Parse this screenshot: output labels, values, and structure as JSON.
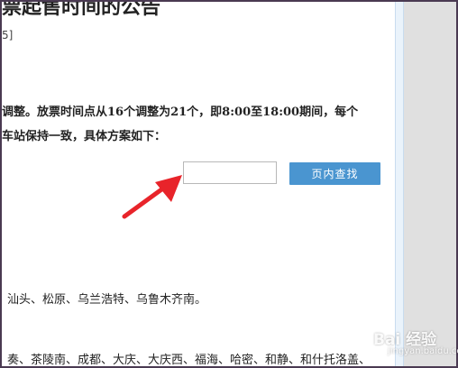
{
  "article": {
    "title": "票起售时间的公告",
    "subnote": "5]",
    "paragraph_line1": "调整。放票时间点从16个调整为21个，即8:00至18:00期间，每个",
    "paragraph_line2": "车站保持一致，具体方案如下：",
    "station_line1": "汕头、松原、乌兰浩特、乌鲁木齐南。",
    "station_line2": "奏、茶陵南、成都、大庆、大庆西、福海、哈密、和静、和什托洛盖、"
  },
  "find_bar": {
    "input_value": "",
    "button_label": "页内查找"
  },
  "watermark": {
    "brand": "Bai 经验",
    "url": "jingyan.baidu.com"
  },
  "colors": {
    "button": "#4a95d0",
    "arrow": "#e8242a",
    "scrollbar": "#e0e0e0"
  },
  "icons": {
    "annotation": "red-arrow-icon",
    "watermark": "baidu-paw-icon"
  }
}
